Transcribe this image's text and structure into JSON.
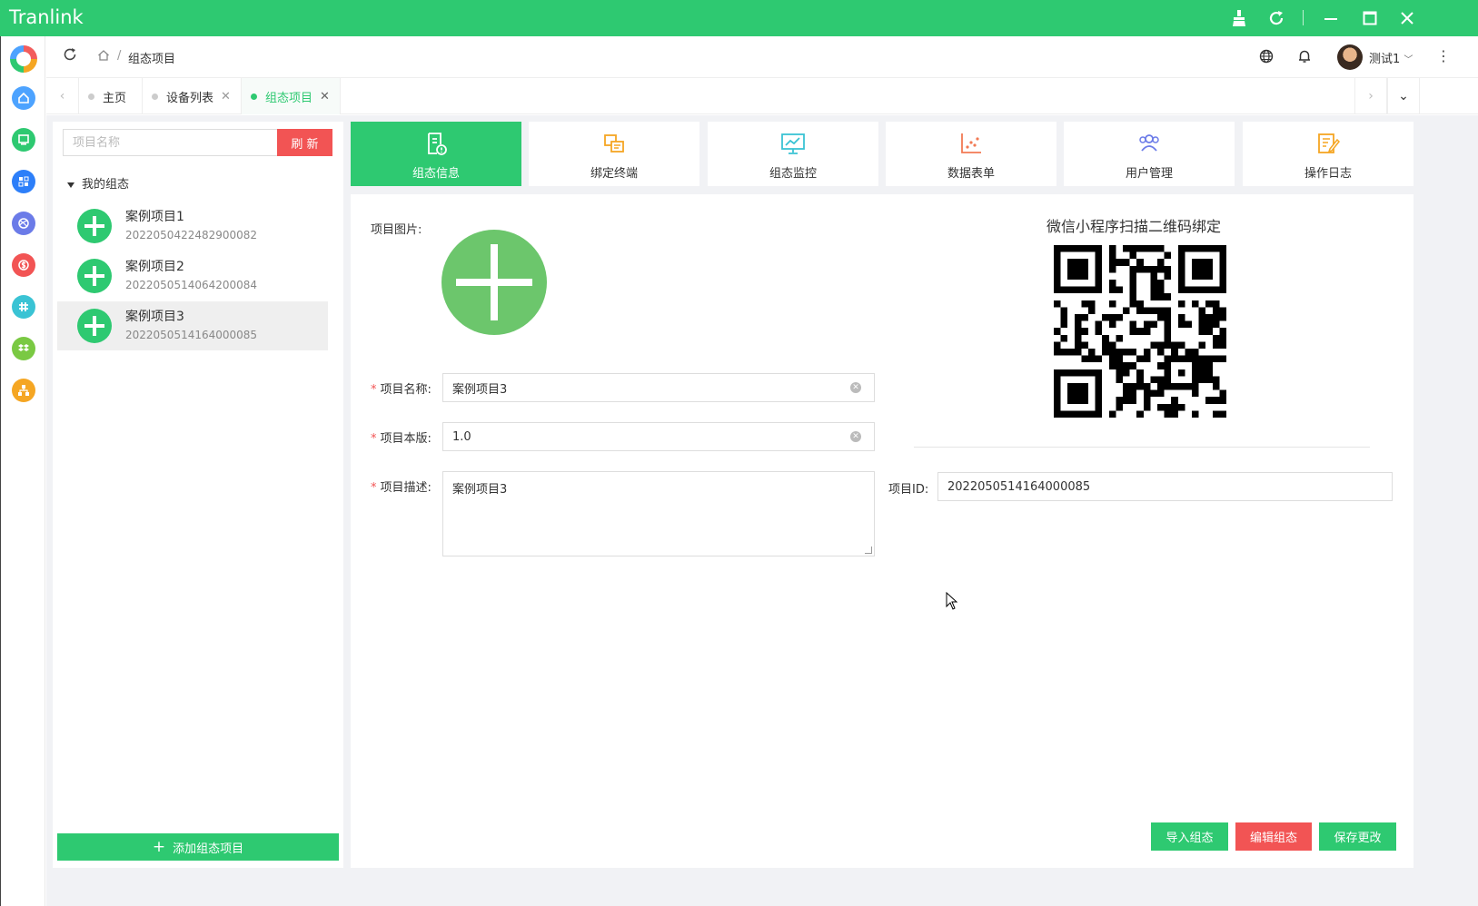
{
  "window": {
    "title": "Tranlink",
    "accent": "#2ec971"
  },
  "titlebar_icons": [
    "broom-icon",
    "refresh-icon",
    "minimize-icon",
    "maximize-icon",
    "close-icon"
  ],
  "rail": {
    "items": [
      {
        "name": "home-icon",
        "color": "#4da3ff"
      },
      {
        "name": "monitor-icon",
        "color": "#2ec971"
      },
      {
        "name": "dashboard-icon",
        "color": "#2d7ff9"
      },
      {
        "name": "dribbble-icon",
        "color": "#6b7be8"
      },
      {
        "name": "dollar-icon",
        "color": "#f25454"
      },
      {
        "name": "slack-icon",
        "color": "#3ac3d4"
      },
      {
        "name": "dropbox-icon",
        "color": "#7ac943"
      },
      {
        "name": "org-chart-icon",
        "color": "#f5a623"
      }
    ]
  },
  "header": {
    "breadcrumb": "组态项目",
    "username": "测试1",
    "more": "⋮"
  },
  "tabs": [
    {
      "label": "主页",
      "closable": false,
      "active": false
    },
    {
      "label": "设备列表",
      "closable": true,
      "active": false
    },
    {
      "label": "组态项目",
      "closable": true,
      "active": true
    }
  ],
  "left_panel": {
    "search_placeholder": "项目名称",
    "refresh_label": "刷 新",
    "tree_root": "我的组态",
    "projects": [
      {
        "name": "案例项目1",
        "id": "2022050422482900082",
        "selected": false
      },
      {
        "name": "案例项目2",
        "id": "2022050514064200084",
        "selected": false
      },
      {
        "name": "案例项目3",
        "id": "2022050514164000085",
        "selected": true
      }
    ],
    "add_label": "添加组态项目"
  },
  "function_tabs": [
    {
      "label": "组态信息",
      "icon": "info-doc-icon",
      "active": true
    },
    {
      "label": "绑定终端",
      "icon": "bind-terminal-icon",
      "active": false
    },
    {
      "label": "组态监控",
      "icon": "monitor-chart-icon",
      "active": false
    },
    {
      "label": "数据表单",
      "icon": "scatter-chart-icon",
      "active": false
    },
    {
      "label": "用户管理",
      "icon": "users-icon",
      "active": false
    },
    {
      "label": "操作日志",
      "icon": "log-edit-icon",
      "active": false
    }
  ],
  "form": {
    "image_label": "项目图片:",
    "name_label": "项目名称:",
    "name_value": "案例项目3",
    "version_label": "项目本版:",
    "version_value": "1.0",
    "desc_label": "项目描述:",
    "desc_value": "案例项目3",
    "id_label": "项目ID:",
    "id_value": "2022050514164000085",
    "required_mark": "*"
  },
  "qr": {
    "title": "微信小程序扫描二维码绑定"
  },
  "actions": {
    "import_label": "导入组态",
    "edit_label": "编辑组态",
    "save_label": "保存更改"
  }
}
